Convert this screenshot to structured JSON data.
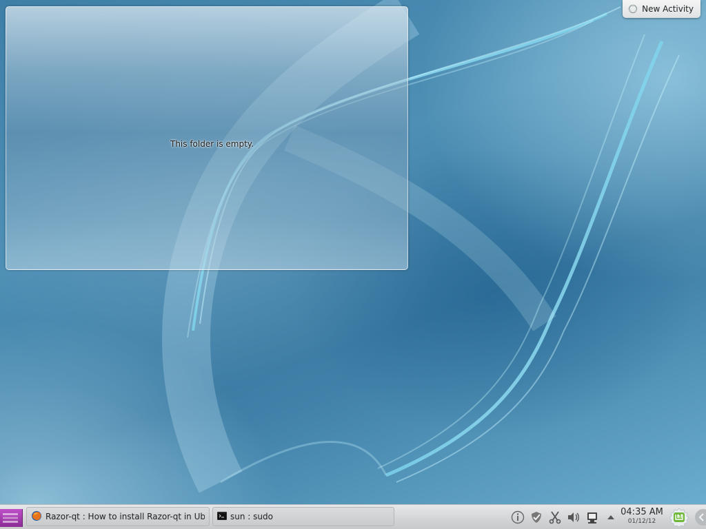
{
  "desktop": {
    "folder_view": {
      "empty_message": "This folder is empty."
    },
    "activity_button": {
      "label": "New Activity",
      "icon": "activity-icon"
    }
  },
  "taskbar": {
    "launcher_icon": "application-launcher-icon",
    "tasks": [
      {
        "label": "Razor-qt : How to install Razor-qt in Ubunt",
        "icon": "firefox-icon"
      },
      {
        "label": "sun : sudo",
        "icon": "terminal-icon"
      }
    ],
    "tray_icons": [
      "info-icon",
      "shield-check-icon",
      "scissors-icon",
      "volume-icon",
      "network-icon",
      "tray-expand-arrow-icon"
    ],
    "clock": {
      "time": "04:35 AM",
      "date": "01/12/12"
    },
    "menu_icon": "linux-mint-icon"
  },
  "colors": {
    "wallpaper_base": "#3e7fa8",
    "panel": "#d5d7d9",
    "launcher": "#a33bb0",
    "mint_green": "#6fb83a"
  }
}
